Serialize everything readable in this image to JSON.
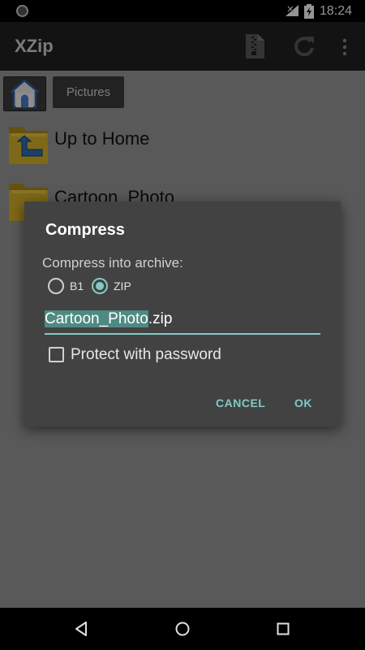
{
  "status_bar": {
    "time": "18:24"
  },
  "toolbar": {
    "title": "XZip",
    "icons": [
      "archive-icon",
      "refresh-icon",
      "overflow-menu-icon"
    ]
  },
  "breadcrumb": {
    "home_icon": "home-icon",
    "current": "Pictures"
  },
  "files": [
    {
      "name": "Up to Home",
      "icon": "folder-up-icon"
    },
    {
      "name": "Cartoon_Photo",
      "icon": "folder-icon"
    }
  ],
  "dialog": {
    "title": "Compress",
    "label": "Compress into archive:",
    "formats": [
      {
        "label": "B1",
        "selected": false
      },
      {
        "label": "ZIP",
        "selected": true
      }
    ],
    "filename_selected": "Cartoon_Photo",
    "filename_ext": ".zip",
    "password_label": "Protect with password",
    "password_checked": false,
    "cancel_label": "CANCEL",
    "ok_label": "OK"
  },
  "colors": {
    "accent": "#80cbc4",
    "dialog_bg": "#424242",
    "toolbar_bg": "#212121",
    "content_bg": "#9a9a9a"
  }
}
